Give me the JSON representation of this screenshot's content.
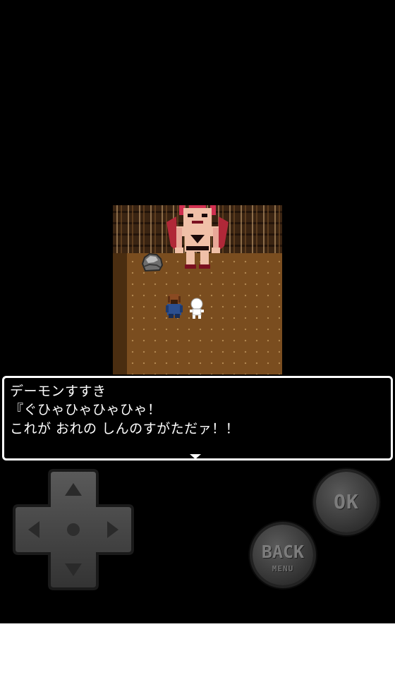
{
  "dialog": {
    "speaker": "デーモンすすき",
    "line1": "『ぐひゃひゃひゃひゃ！",
    "line2": "これが おれの しんのすがただァ！！"
  },
  "controls": {
    "ok_label": "OK",
    "back_label": "BACK",
    "menu_label": "MENU"
  },
  "dpad": {
    "up_icon": "arrow-up-icon",
    "down_icon": "arrow-down-icon",
    "left_icon": "arrow-left-icon",
    "right_icon": "arrow-right-icon"
  },
  "colors": {
    "background": "#000000",
    "dialog_border": "#ffffff",
    "dialog_text": "#ffffff",
    "floor": "#7a4d1f",
    "demon_body": "#e8b0a0",
    "demon_horns": "#d03050",
    "button_face": "#3a3a3a",
    "button_label": "#7c7c7c"
  }
}
